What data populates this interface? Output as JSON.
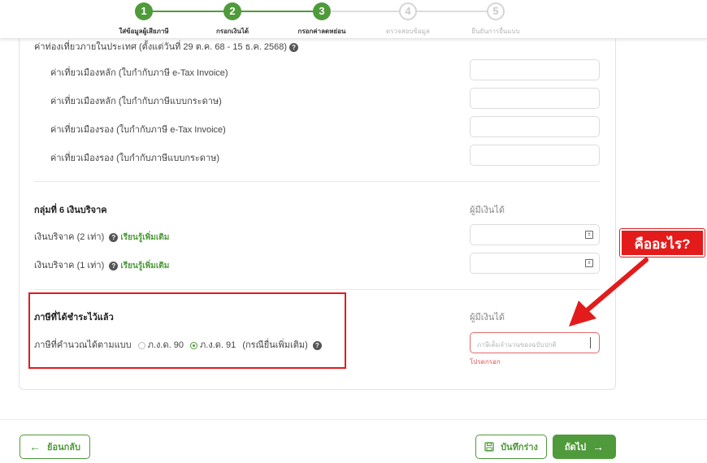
{
  "stepper": {
    "steps": [
      {
        "number": "1",
        "label": "ใส่ข้อมูลผู้เสียภาษี",
        "status": "done"
      },
      {
        "number": "2",
        "label": "กรอกเงินได้",
        "status": "done"
      },
      {
        "number": "3",
        "label": "กรอกค่าลดหย่อน",
        "status": "done"
      },
      {
        "number": "4",
        "label": "ตรวจสอบข้อมูล",
        "status": "todo"
      },
      {
        "number": "5",
        "label": "ยืนยันการยื่นแบบ",
        "status": "todo"
      }
    ]
  },
  "tourism": {
    "title": "ค่าท่องเที่ยวภายในประเทศ (ตั้งแต่วันที่ 29 ต.ค. 68 - 15 ธ.ค. 2568)",
    "items": [
      {
        "label": "ค่าเที่ยวเมืองหลัก (ใบกำกับภาษี e-Tax Invoice)",
        "value": ""
      },
      {
        "label": "ค่าเที่ยวเมืองหลัก (ใบกำกับภาษีแบบกระดาษ)",
        "value": ""
      },
      {
        "label": "ค่าเที่ยวเมืองรอง (ใบกำกับภาษี e-Tax Invoice)",
        "value": ""
      },
      {
        "label": "ค่าเที่ยวเมืองรอง (ใบกำกับภาษีแบบกระดาษ)",
        "value": ""
      }
    ]
  },
  "group6": {
    "title": "กลุ่มที่ 6 เงินบริจาค",
    "column_header": "ผู้มีเงินได้",
    "items": [
      {
        "label": "เงินบริจาค (2 เท่า)",
        "link": "เรียนรู้เพิ่มเติม",
        "value": ""
      },
      {
        "label": "เงินบริจาค (1 เท่า)",
        "link": "เรียนรู้เพิ่มเติม",
        "value": ""
      }
    ]
  },
  "taxpaid": {
    "title": "ภาษีที่ได้ชำระไว้แล้ว",
    "column_header": "ผู้มีเงินได้",
    "calc_label": "ภาษีที่คำนวณได้ตามแบบ",
    "options": [
      {
        "label": "ภ.ง.ด. 90",
        "selected": false
      },
      {
        "label": "ภ.ง.ด. 91",
        "selected": true
      }
    ],
    "note": "(กรณียื่นเพิ่มเติม)",
    "input_placeholder": "ภาษีเต็มจำนวนของฉบับปกติ",
    "error_text": "โปรดกรอก"
  },
  "callout": {
    "text": "คืออะไร?"
  },
  "footer": {
    "back_label": "ย้อนกลับ",
    "save_label": "บันทึกร่าง",
    "next_label": "ถัดไป"
  },
  "colors": {
    "accent": "#4f9a3a",
    "annotation": "#e31b1b"
  }
}
